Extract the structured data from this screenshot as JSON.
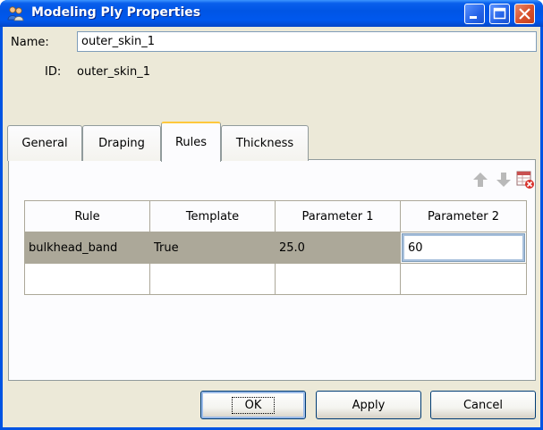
{
  "window": {
    "title": "Modeling Ply Properties",
    "title_icon": "people-icon",
    "controls": [
      "minimize-icon",
      "maximize-icon",
      "close-icon"
    ]
  },
  "form": {
    "name_label": "Name:",
    "name_value": "outer_skin_1",
    "id_label": "ID:",
    "id_value": "outer_skin_1"
  },
  "tabs": [
    {
      "label": "General",
      "active": false
    },
    {
      "label": "Draping",
      "active": false
    },
    {
      "label": "Rules",
      "active": true
    },
    {
      "label": "Thickness",
      "active": false
    }
  ],
  "toolbar": {
    "icons": [
      "arrow-up-icon",
      "arrow-down-icon",
      "delete-row-icon"
    ]
  },
  "table": {
    "columns": [
      "Rule",
      "Template",
      "Parameter 1",
      "Parameter 2"
    ],
    "rows": [
      {
        "rule": "bulkhead_band",
        "template": "True",
        "parameter1": "25.0",
        "parameter2": "60"
      }
    ]
  },
  "buttons": {
    "ok": "OK",
    "apply": "Apply",
    "cancel": "Cancel"
  },
  "colors": {
    "titlebar": "#0054e3",
    "dialog_bg": "#ece9d8",
    "selected_row": "#aca899",
    "active_tab_accent": "#ffc83c"
  }
}
